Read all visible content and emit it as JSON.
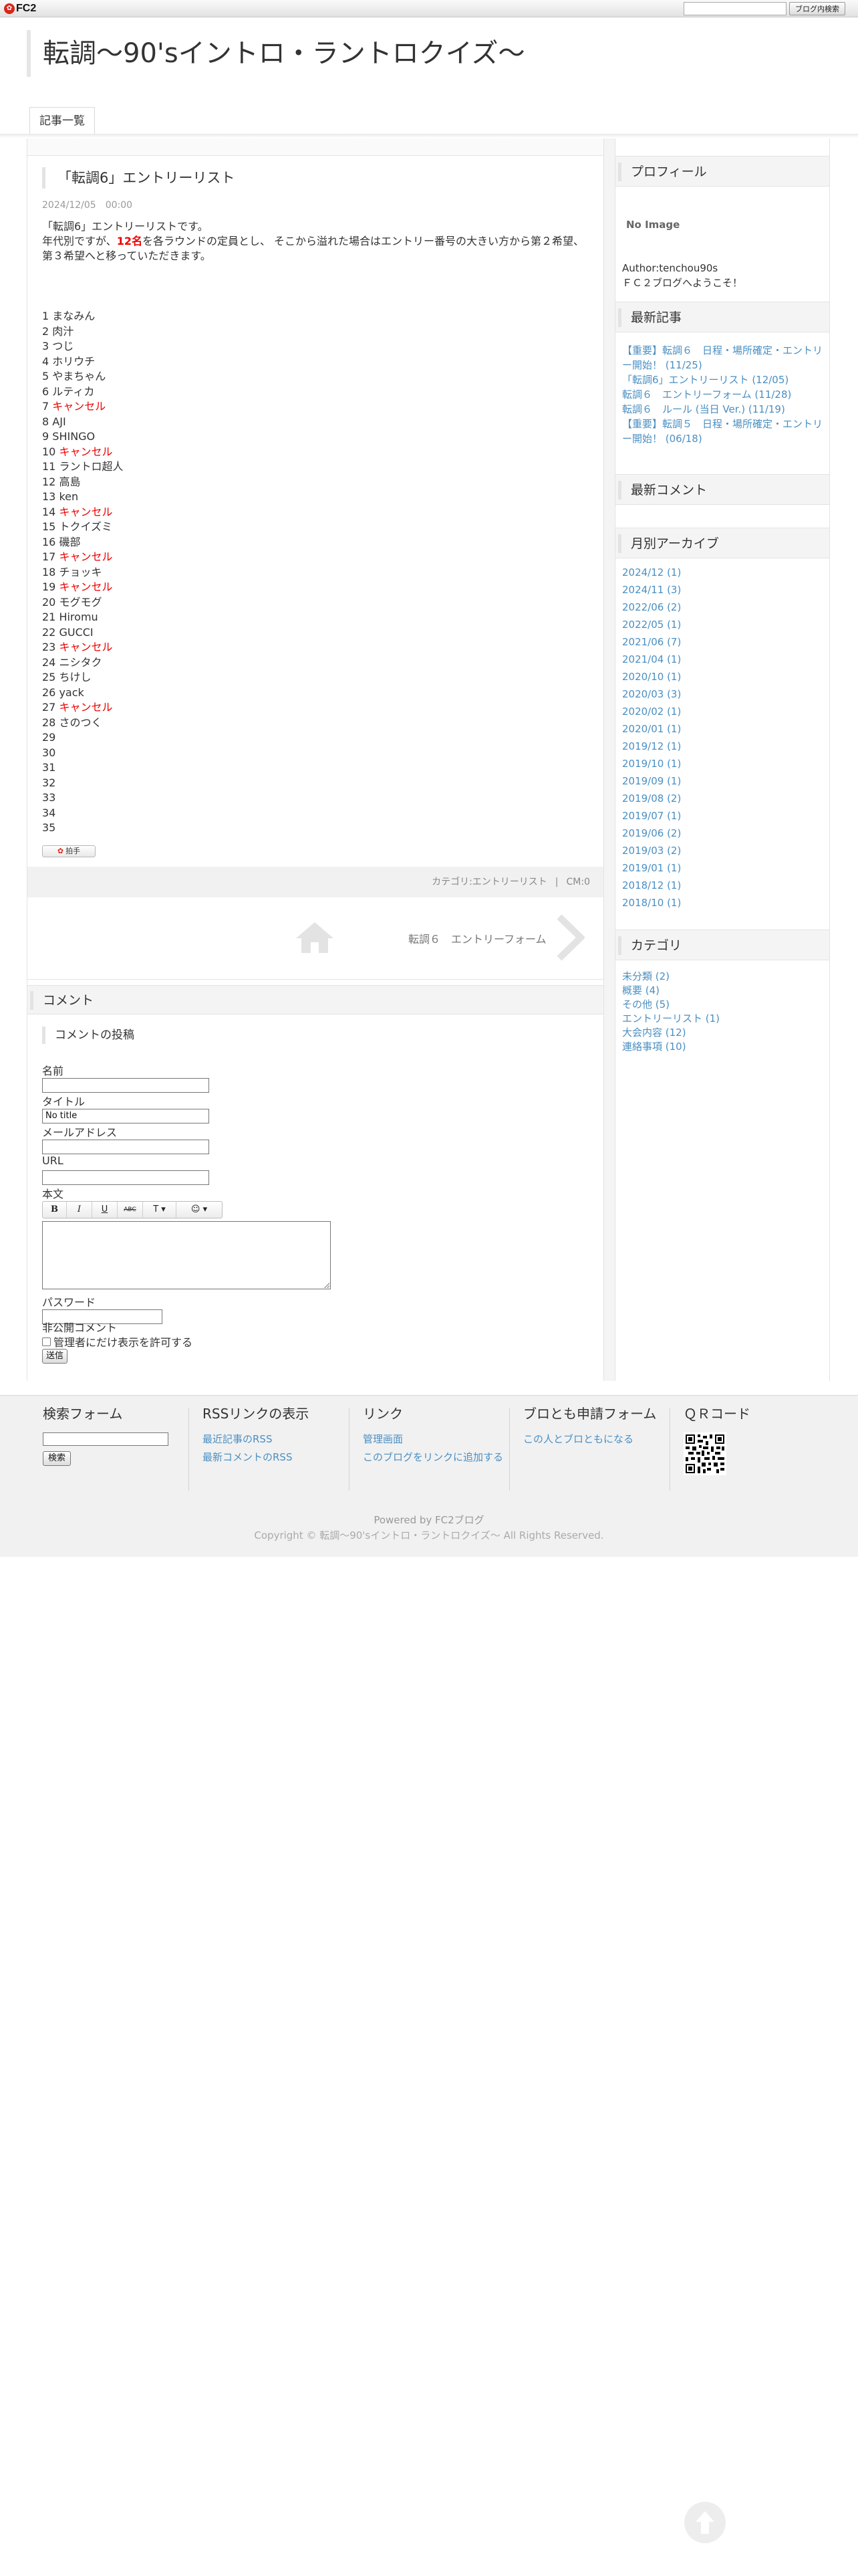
{
  "fc2bar": {
    "logo_text": "FC2",
    "search_button": "ブログ内検索",
    "accent": "#d6271a"
  },
  "header": {
    "blog_title": "転調〜90'sイントロ・ラントロクイズ〜",
    "nav_tab": "記事一覧"
  },
  "entry": {
    "title": "「転調6」エントリーリスト",
    "date": "2024/12/05",
    "time": "00:00",
    "body_line1": "「転調6」エントリーリストです。",
    "body_line2_pre": "年代別ですが、",
    "body_line2_highlight": "12名",
    "body_line2_post": "を各ラウンドの定員とし、 そこから溢れた場合はエントリー番号の大きい方から第２希望、",
    "body_line3": "第３希望へと移っていただきます。",
    "entries": [
      {
        "no": "1",
        "name": "まなみん",
        "cancel": false
      },
      {
        "no": "2",
        "name": "肉汁",
        "cancel": false
      },
      {
        "no": "3",
        "name": "つじ",
        "cancel": false
      },
      {
        "no": "4",
        "name": "ホリウチ",
        "cancel": false
      },
      {
        "no": "5",
        "name": "やまちゃん",
        "cancel": false
      },
      {
        "no": "6",
        "name": "ルティカ",
        "cancel": false
      },
      {
        "no": "7",
        "name": "キャンセル",
        "cancel": true
      },
      {
        "no": "8",
        "name": "AJI",
        "cancel": false
      },
      {
        "no": "9",
        "name": "SHINGO",
        "cancel": false
      },
      {
        "no": "10",
        "name": "キャンセル",
        "cancel": true
      },
      {
        "no": "11",
        "name": "ラントロ超人",
        "cancel": false
      },
      {
        "no": "12",
        "name": "高島",
        "cancel": false
      },
      {
        "no": "13",
        "name": "ken",
        "cancel": false
      },
      {
        "no": "14",
        "name": "キャンセル",
        "cancel": true
      },
      {
        "no": "15",
        "name": "トクイズミ",
        "cancel": false
      },
      {
        "no": "16",
        "name": "磯部",
        "cancel": false
      },
      {
        "no": "17",
        "name": "キャンセル",
        "cancel": true
      },
      {
        "no": "18",
        "name": "チョッキ",
        "cancel": false
      },
      {
        "no": "19",
        "name": "キャンセル",
        "cancel": true
      },
      {
        "no": "20",
        "name": "モグモグ",
        "cancel": false
      },
      {
        "no": "21",
        "name": "Hiromu",
        "cancel": false
      },
      {
        "no": "22",
        "name": "GUCCI",
        "cancel": false
      },
      {
        "no": "23",
        "name": "キャンセル",
        "cancel": true
      },
      {
        "no": "24",
        "name": "ニシタク",
        "cancel": false
      },
      {
        "no": "25",
        "name": "ちけし",
        "cancel": false
      },
      {
        "no": "26",
        "name": "yack",
        "cancel": false
      },
      {
        "no": "27",
        "name": "キャンセル",
        "cancel": true
      },
      {
        "no": "28",
        "name": "さのつく",
        "cancel": false
      },
      {
        "no": "29",
        "name": "",
        "cancel": false
      },
      {
        "no": "30",
        "name": "",
        "cancel": false
      },
      {
        "no": "31",
        "name": "",
        "cancel": false
      },
      {
        "no": "32",
        "name": "",
        "cancel": false
      },
      {
        "no": "33",
        "name": "",
        "cancel": false
      },
      {
        "no": "34",
        "name": "",
        "cancel": false
      },
      {
        "no": "35",
        "name": "",
        "cancel": false
      }
    ],
    "clap_label": "拍手",
    "category": "カテゴリ:エントリーリスト",
    "comment_count": "CM:0",
    "next_article": "転調６　エントリーフォーム",
    "cancel_color": "#e00000"
  },
  "comment_form": {
    "section_title": "コメント",
    "post_title": "コメントの投稿",
    "name_label": "名前",
    "title_label": "タイトル",
    "title_value": "No title",
    "mail_label": "メールアドレス",
    "url_label": "URL",
    "body_label": "本文",
    "toolbar": [
      "B",
      "I",
      "U",
      "ABC",
      "T ▾",
      "☺ ▾"
    ],
    "password_label": "パスワード",
    "secret_label": "非公開コメント",
    "secret_checkbox": "管理者にだけ表示を許可する",
    "submit": "送信"
  },
  "sidebar": {
    "profile_title": "プロフィール",
    "no_image": "No Image",
    "author": "Author:tenchou90s",
    "welcome": "ＦＣ２ブログへようこそ！",
    "recent_title": "最新記事",
    "recent": [
      "【重要】転調６　日程・場所確定・エントリー開始！ (11/25)",
      "「転調6」エントリーリスト (12/05)",
      "転調６　エントリーフォーム (11/28)",
      "転調６　ルール (当日 Ver.) (11/19)",
      "【重要】転調５　日程・場所確定・エントリー開始！ (06/18)"
    ],
    "comments_title": "最新コメント",
    "archive_title": "月別アーカイブ",
    "archive": [
      "2024/12 (1)",
      "2024/11 (3)",
      "2022/06 (2)",
      "2022/05 (1)",
      "2021/06 (7)",
      "2021/04 (1)",
      "2020/10 (1)",
      "2020/03 (3)",
      "2020/02 (1)",
      "2020/01 (1)",
      "2019/12 (1)",
      "2019/10 (1)",
      "2019/09 (1)",
      "2019/08 (2)",
      "2019/07 (1)",
      "2019/06 (2)",
      "2019/03 (2)",
      "2019/01 (1)",
      "2018/12 (1)",
      "2018/10 (1)"
    ],
    "category_title": "カテゴリ",
    "categories": [
      "未分類 (2)",
      "概要 (4)",
      "その他 (5)",
      "エントリーリスト (1)",
      "大会内容 (12)",
      "連絡事項 (10)"
    ]
  },
  "footer": {
    "search_title": "検索フォーム",
    "search_button": "検索",
    "rss_title": "RSSリンクの表示",
    "rss_links": [
      "最近記事のRSS",
      "最新コメントのRSS"
    ],
    "link_title": "リンク",
    "links": [
      "管理画面",
      "このブログをリンクに追加する"
    ],
    "friend_title": "ブロとも申請フォーム",
    "friend_link": "この人とブロともになる",
    "qr_title": "ＱＲコード",
    "powered": "Powered by FC2ブログ",
    "copyright": "Copyright © 転調〜90'sイントロ・ラントロクイズ〜 All Rights Reserved."
  }
}
